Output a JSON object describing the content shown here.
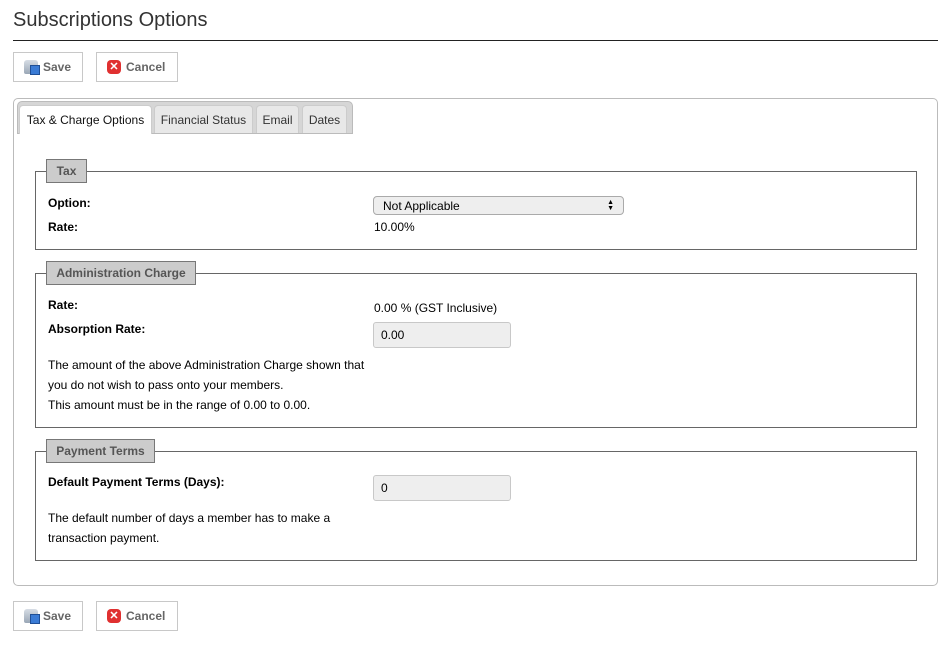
{
  "page_title": "Subscriptions Options",
  "toolbar": {
    "save_label": "Save",
    "cancel_label": "Cancel"
  },
  "tabs": [
    {
      "label": "Tax & Charge Options"
    },
    {
      "label": "Financial Status"
    },
    {
      "label": "Email"
    },
    {
      "label": "Dates"
    }
  ],
  "tax": {
    "legend": "Tax",
    "option_label": "Option:",
    "option_value": "Not Applicable",
    "rate_label": "Rate:",
    "rate_value": "10.00%"
  },
  "admin": {
    "legend": "Administration Charge",
    "rate_label": "Rate:",
    "rate_value": "0.00 % (GST Inclusive)",
    "absorption_label": "Absorption Rate:",
    "absorption_value": "0.00",
    "help1": "The amount of the above Administration Charge shown that you do not wish to pass onto your members.",
    "help2": "This amount must be in the range of 0.00 to 0.00."
  },
  "payment": {
    "legend": "Payment Terms",
    "terms_label": "Default Payment Terms (Days):",
    "terms_value": "0",
    "help": "The default number of days a member has to make a transaction payment."
  }
}
